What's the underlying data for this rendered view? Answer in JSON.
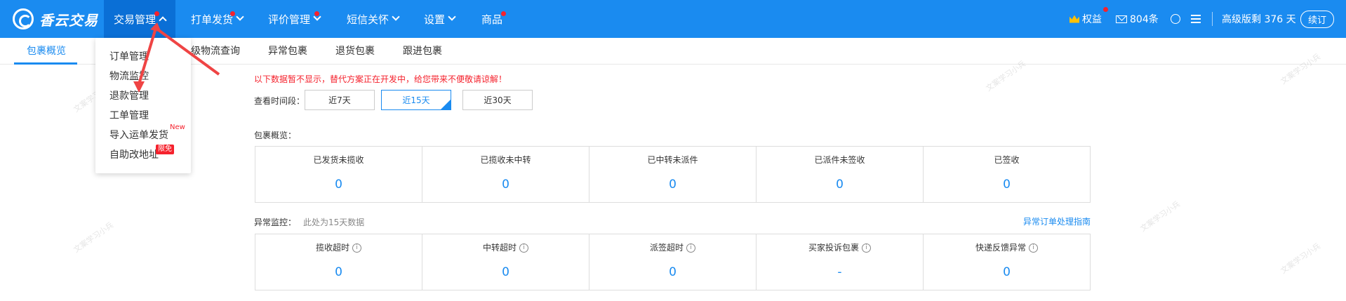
{
  "header": {
    "logo_text": "香云交易",
    "nav": [
      {
        "label": "交易管理"
      },
      {
        "label": "打单发货"
      },
      {
        "label": "评价管理"
      },
      {
        "label": "短信关怀"
      },
      {
        "label": "设置"
      },
      {
        "label": "商品"
      }
    ],
    "benefits_label": "权益",
    "messages_label": "804条",
    "plan_text": "高级版剩 376 天",
    "renew_label": "续订"
  },
  "subtabs": {
    "items": [
      {
        "label": "包裹概览"
      },
      {
        "label": "级物流查询"
      },
      {
        "label": "异常包裹"
      },
      {
        "label": "退货包裹"
      },
      {
        "label": "跟进包裹"
      }
    ]
  },
  "dropdown": {
    "items": [
      {
        "label": "订单管理"
      },
      {
        "label": "物流监控"
      },
      {
        "label": "退款管理"
      },
      {
        "label": "工单管理"
      },
      {
        "label": "导入运单发货"
      },
      {
        "label": "自助改地址"
      }
    ],
    "new_badge": "New",
    "free_badge": "限免"
  },
  "notice": "以下数据暂不显示，替代方案正在开发中，给您带来不便敬请谅解！",
  "period": {
    "label": "查看时间段：",
    "options": [
      {
        "label": "近7天"
      },
      {
        "label": "近15天"
      },
      {
        "label": "近30天"
      }
    ],
    "selected": "近15天"
  },
  "overview": {
    "label": "包裹概览：",
    "cells": [
      {
        "title": "已发货未揽收",
        "value": "0"
      },
      {
        "title": "已揽收未中转",
        "value": "0"
      },
      {
        "title": "已中转未派件",
        "value": "0"
      },
      {
        "title": "已派件未签收",
        "value": "0"
      },
      {
        "title": "已签收",
        "value": "0"
      }
    ]
  },
  "abnormal": {
    "label": "异常监控：",
    "sublabel": "此处为15天数据",
    "guide_link": "异常订单处理指南",
    "cells": [
      {
        "title": "揽收超时",
        "value": "0"
      },
      {
        "title": "中转超时",
        "value": "0"
      },
      {
        "title": "派签超时",
        "value": "0"
      },
      {
        "title": "买家投诉包裹",
        "value": "-"
      },
      {
        "title": "快递反馈异常",
        "value": "0"
      }
    ]
  },
  "info_glyph": "i",
  "watermark_text": "文案学习小兵",
  "colors": {
    "primary": "#1a8bf0",
    "active_nav": "#0a6fd6",
    "alert": "#f5222d",
    "arrow": "#ef4444"
  }
}
